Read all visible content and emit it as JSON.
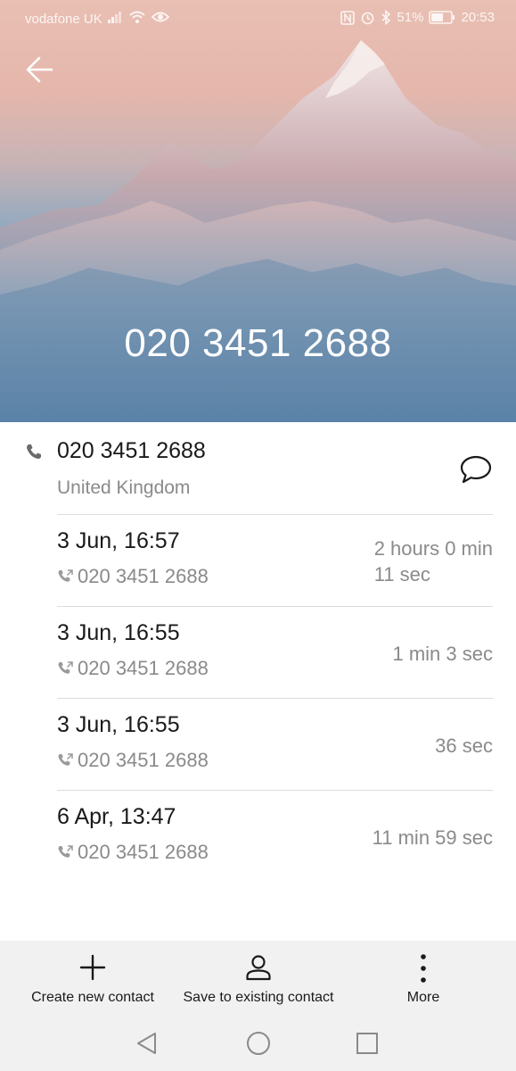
{
  "status_bar": {
    "carrier": "vodafone UK",
    "battery": "51%",
    "time": "20:53"
  },
  "header": {
    "number": "020 3451 2688"
  },
  "detail": {
    "number": "020 3451 2688",
    "location": "United Kingdom"
  },
  "calls": [
    {
      "time": "3 Jun, 16:57",
      "number": "020 3451 2688",
      "duration_line1": "2 hours 0 min",
      "duration_line2": "11 sec"
    },
    {
      "time": "3 Jun, 16:55",
      "number": "020 3451 2688",
      "duration_line1": "1 min 3 sec",
      "duration_line2": ""
    },
    {
      "time": "3 Jun, 16:55",
      "number": "020 3451 2688",
      "duration_line1": "36 sec",
      "duration_line2": ""
    },
    {
      "time": "6 Apr, 13:47",
      "number": "020 3451 2688",
      "duration_line1": "11 min 59 sec",
      "duration_line2": ""
    }
  ],
  "actions": {
    "create": "Create new contact",
    "save_existing": "Save to existing contact",
    "more": "More"
  },
  "icons": {
    "back": "back-arrow-icon",
    "phone": "phone-icon",
    "message": "message-icon",
    "outgoing": "outgoing-call-icon",
    "add": "plus-icon",
    "person": "person-icon",
    "more": "more-vertical-icon"
  }
}
